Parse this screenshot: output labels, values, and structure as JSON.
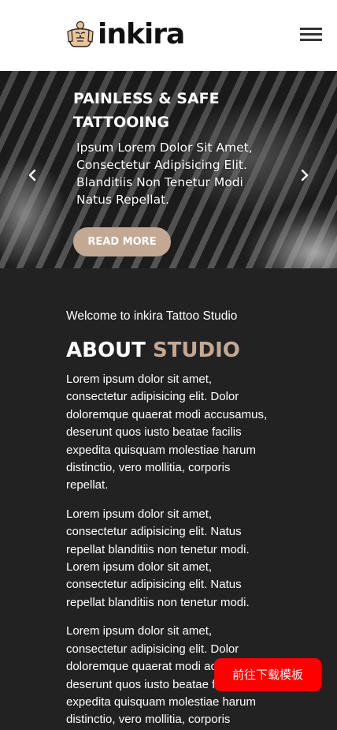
{
  "header": {
    "logo_text": "inkira",
    "logo_icon": "tattooed-torso-icon",
    "menu_icon": "hamburger-menu-icon"
  },
  "hero": {
    "title": "PAINLESS & SAFE TATTOOING",
    "text": "Ipsum Lorem Dolor Sit Amet, Consectetur Adipisicing Elit. Blanditiis Non Tenetur Modi Natus Repellat.",
    "button_label": "READ MORE",
    "prev_icon": "chevron-left-icon",
    "next_icon": "chevron-right-icon"
  },
  "about": {
    "welcome": "Welcome to inkira Tattoo Studio",
    "title_main": "ABOUT",
    "title_accent": "STUDIO",
    "paragraphs": [
      "Lorem ipsum dolor sit amet, consectetur adipisicing elit. Dolor doloremque quaerat modi accusamus, deserunt quos iusto beatae facilis expedita quisquam molestiae harum distinctio, vero mollitia, corporis repellat.",
      "Lorem ipsum dolor sit amet, consectetur adipisicing elit. Natus repellat blanditiis non tenetur modi. Lorem ipsum dolor sit amet, consectetur adipisicing elit. Natus repellat blanditiis non tenetur modi.",
      "Lorem ipsum dolor sit amet, consectetur adipisicing elit. Dolor doloremque quaerat modi accusamus, deserunt quos iusto beatae facilis expedita quisquam molestiae harum distinctio, vero mollitia, corporis repellat."
    ]
  },
  "cta": {
    "label": "前往下载模板"
  },
  "colors": {
    "accent": "#c3a993",
    "dark_background": "#222222",
    "cta_red": "#ff0000"
  }
}
